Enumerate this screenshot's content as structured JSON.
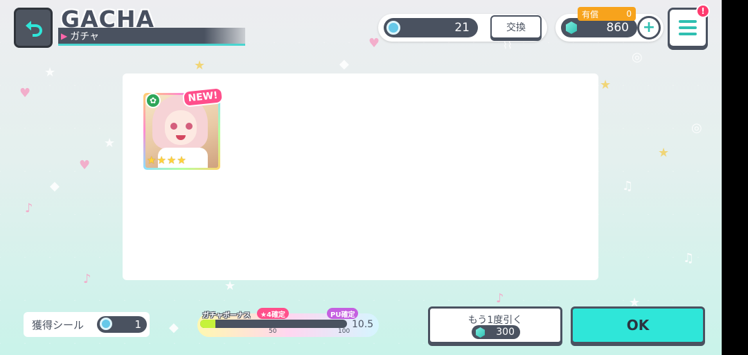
{
  "header": {
    "title": "GACHA",
    "subtitle": "ガチャ"
  },
  "currency": {
    "stickers_count": "21",
    "exchange_label": "交換",
    "paid_label": "有償",
    "paid_count": "0",
    "gems_count": "860",
    "notice_badge": "!"
  },
  "result": {
    "new_tag": "NEW!",
    "rarity_stars": 4
  },
  "footer": {
    "sticker_label": "獲得シール",
    "sticker_count": "1",
    "bonus_title": "ガチャボーナス",
    "badge_star4": "★4確定",
    "badge_pu": "PU確定",
    "progress_mark_50": "50",
    "progress_mark_100": "100",
    "bonus_value": "10.5",
    "bonus_progress_percent": 10.5,
    "again_label": "もう1度引く",
    "again_cost": "300",
    "ok_label": "OK"
  },
  "colors": {
    "accent_teal": "#2fe6d9",
    "dark": "#4a5260",
    "pink": "#ff4f8b",
    "gold": "#ffd23c"
  }
}
